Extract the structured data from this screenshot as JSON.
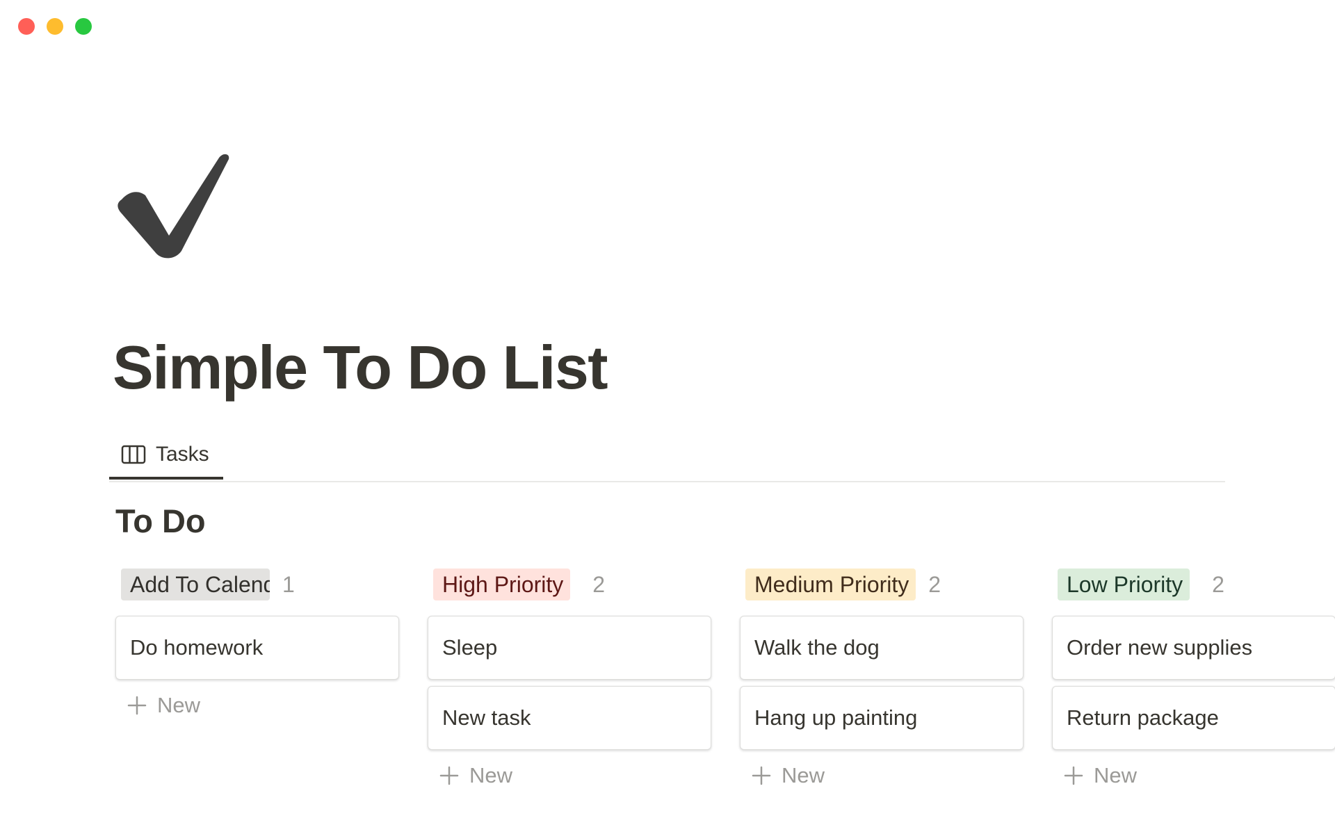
{
  "window": {
    "controls": [
      "close",
      "minimize",
      "maximize"
    ]
  },
  "page": {
    "icon": "checkmark-icon",
    "title": "Simple To Do List"
  },
  "views": {
    "tabs": [
      {
        "label": "Tasks",
        "icon": "board-view-icon",
        "active": true
      }
    ]
  },
  "board": {
    "title": "To Do",
    "new_label": "New",
    "columns": [
      {
        "label": "Add To Calendar",
        "count": "1",
        "tag_bg": "#e3e2e0",
        "tag_color": "#32302c",
        "cards": [
          "Do homework"
        ]
      },
      {
        "label": "High Priority",
        "count": "2",
        "tag_bg": "#ffe2dd",
        "tag_color": "#5d1715",
        "cards": [
          "Sleep",
          "New task"
        ]
      },
      {
        "label": "Medium Priority",
        "count": "2",
        "tag_bg": "#fdecc8",
        "tag_color": "#402c1b",
        "cards": [
          "Walk the dog",
          "Hang up painting"
        ]
      },
      {
        "label": "Low Priority",
        "count": "2",
        "tag_bg": "#dbeddb",
        "tag_color": "#1c3829",
        "cards": [
          "Order new supplies",
          "Return package"
        ]
      }
    ]
  }
}
